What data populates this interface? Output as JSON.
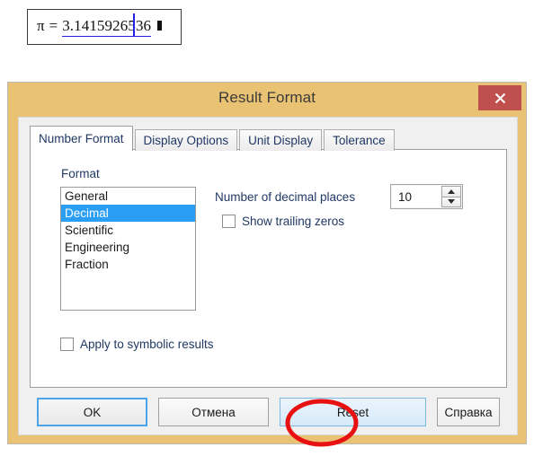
{
  "math_region": {
    "symbol": "π",
    "equals": "=",
    "result_before_caret": "3.1415926",
    "result_after_caret": "536",
    "full_result": "3.1415926536",
    "caret_color": "#2222e0"
  },
  "dialog": {
    "title": "Result Format",
    "close_icon": "close-icon",
    "titlebar_color": "#e9c373",
    "close_button_color": "#c0504d",
    "tabs": [
      {
        "label": "Number Format",
        "active": true
      },
      {
        "label": "Display Options",
        "active": false
      },
      {
        "label": "Unit Display",
        "active": false
      },
      {
        "label": "Tolerance",
        "active": false
      }
    ],
    "number_format_tab": {
      "format_group_label": "Format",
      "format_options": [
        {
          "label": "General",
          "selected": false
        },
        {
          "label": "Decimal",
          "selected": true
        },
        {
          "label": "Scientific",
          "selected": false
        },
        {
          "label": "Engineering",
          "selected": false
        },
        {
          "label": "Fraction",
          "selected": false
        }
      ],
      "selection_color": "#2a9ef4",
      "decimal_places": {
        "label": "Number of decimal places",
        "value": "10"
      },
      "show_trailing_zeros": {
        "label": "Show trailing zeros",
        "checked": false
      },
      "apply_to_symbolic_results": {
        "label": "Apply to symbolic results",
        "checked": false
      }
    },
    "buttons": {
      "ok": "OK",
      "cancel": "Отмена",
      "reset": "Reset",
      "help": "Справка"
    }
  },
  "annotation": {
    "target": "Reset",
    "shape": "ellipse",
    "color": "#e81111"
  }
}
